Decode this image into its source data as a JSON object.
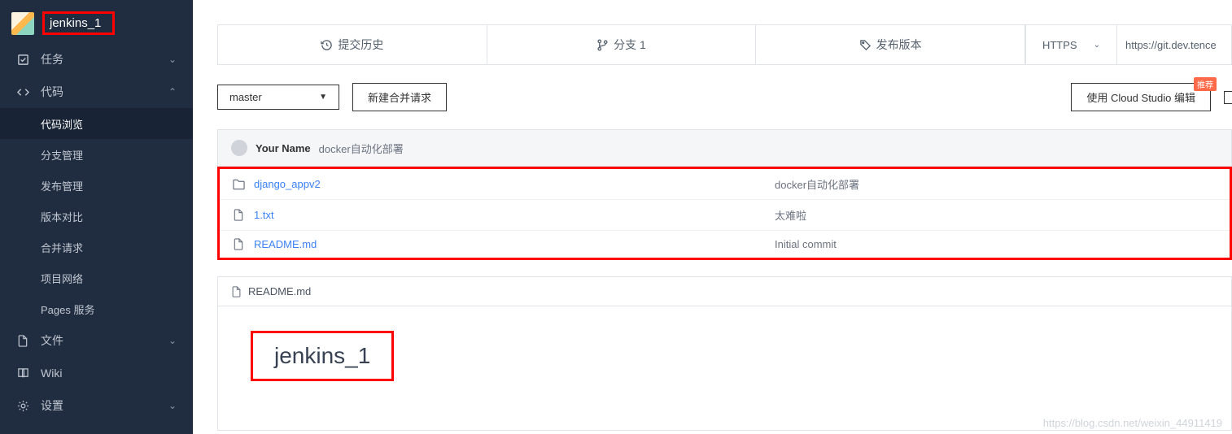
{
  "project": {
    "title": "jenkins_1"
  },
  "sidebar": {
    "items": [
      {
        "label": "任务",
        "icon": "checkbox"
      },
      {
        "label": "代码",
        "icon": "code",
        "expanded": true
      },
      {
        "label": "文件",
        "icon": "file"
      },
      {
        "label": "Wiki",
        "icon": "book"
      },
      {
        "label": "设置",
        "icon": "gear"
      }
    ],
    "code_subs": [
      {
        "label": "代码浏览",
        "active": true
      },
      {
        "label": "分支管理"
      },
      {
        "label": "发布管理"
      },
      {
        "label": "版本对比"
      },
      {
        "label": "合并请求"
      },
      {
        "label": "项目网络"
      },
      {
        "label": "Pages 服务"
      }
    ]
  },
  "tabs": {
    "history": "提交历史",
    "branches": "分支 1",
    "releases": "发布版本"
  },
  "clone": {
    "protocol": "HTTPS",
    "url": "https://git.dev.tence"
  },
  "toolbar": {
    "branch": "master",
    "new_mr": "新建合并请求",
    "cloud_studio": "使用 Cloud Studio 编辑",
    "badge": "推荐"
  },
  "commit": {
    "author": "Your Name",
    "message": "docker自动化部署"
  },
  "files": [
    {
      "name": "django_appv2",
      "type": "folder",
      "message": "docker自动化部署"
    },
    {
      "name": "1.txt",
      "type": "file",
      "message": "太难啦"
    },
    {
      "name": "README.md",
      "type": "file",
      "message": "Initial commit"
    }
  ],
  "readme": {
    "filename": "README.md",
    "heading": "jenkins_1"
  },
  "watermark": "https://blog.csdn.net/weixin_44911419"
}
